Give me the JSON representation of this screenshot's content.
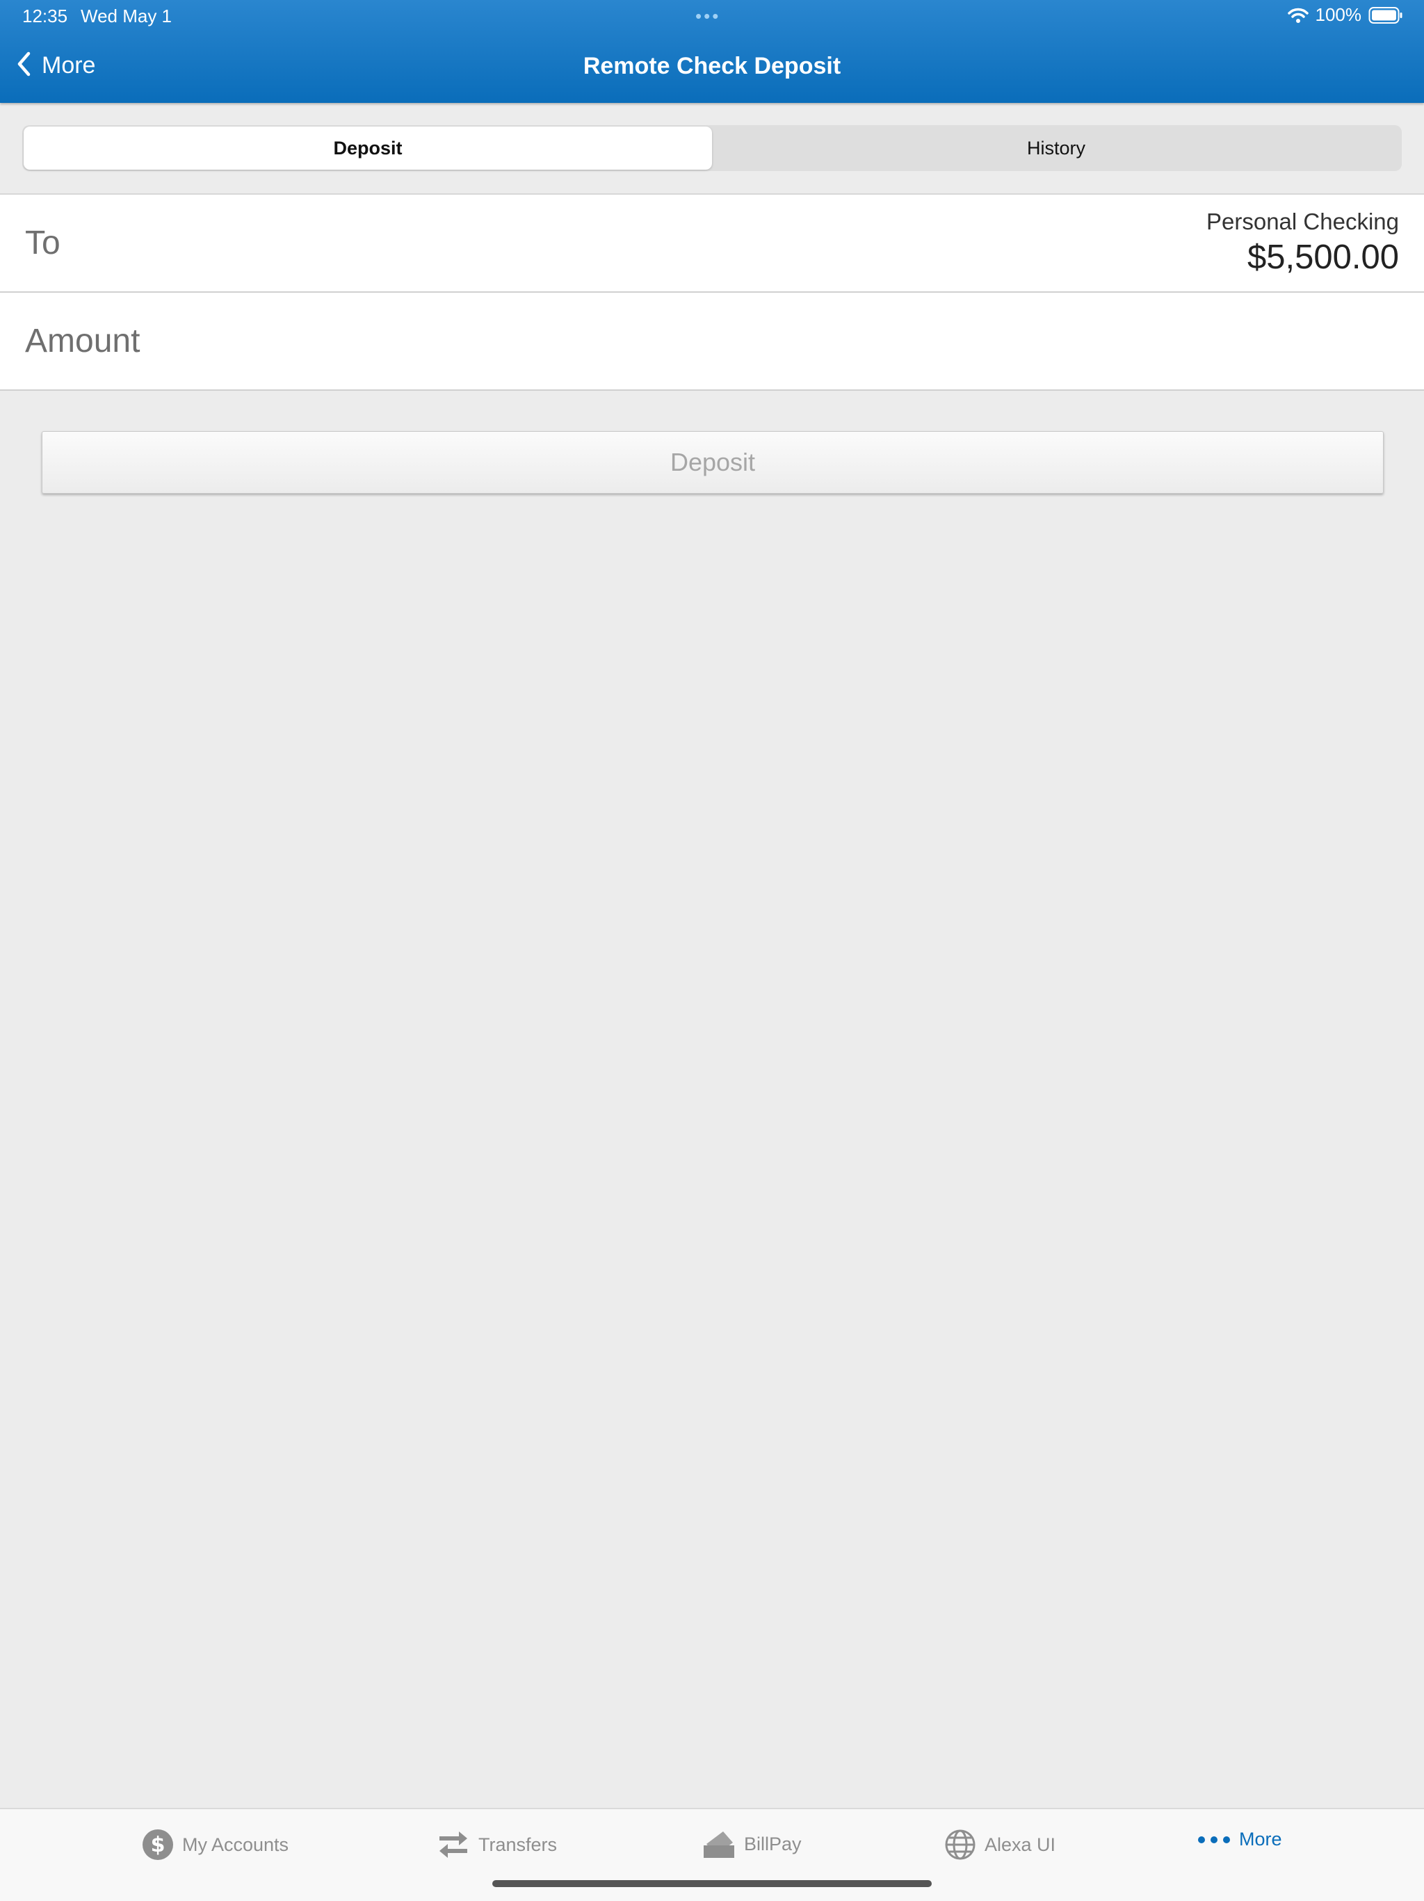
{
  "status_bar": {
    "time": "12:35",
    "date": "Wed May 1",
    "battery": "100%"
  },
  "header": {
    "back_label": "More",
    "title": "Remote Check Deposit",
    "color": "#0a6dba"
  },
  "segments": [
    {
      "label": "Deposit",
      "active": true
    },
    {
      "label": "History",
      "active": false
    }
  ],
  "form": {
    "to_label": "To",
    "to_account_name": "Personal Checking",
    "to_account_balance": "$5,500.00",
    "amount_label": "Amount"
  },
  "deposit_button_label": "Deposit",
  "tabbar": {
    "tabs": [
      {
        "label": "My Accounts",
        "icon": "dollar-circle-icon"
      },
      {
        "label": "Transfers",
        "icon": "transfer-arrows-icon"
      },
      {
        "label": "BillPay",
        "icon": "billpay-icon"
      },
      {
        "label": "Alexa UI",
        "icon": "globe-icon"
      },
      {
        "label": "More",
        "icon": "more-dots-icon",
        "active": true
      }
    ]
  }
}
